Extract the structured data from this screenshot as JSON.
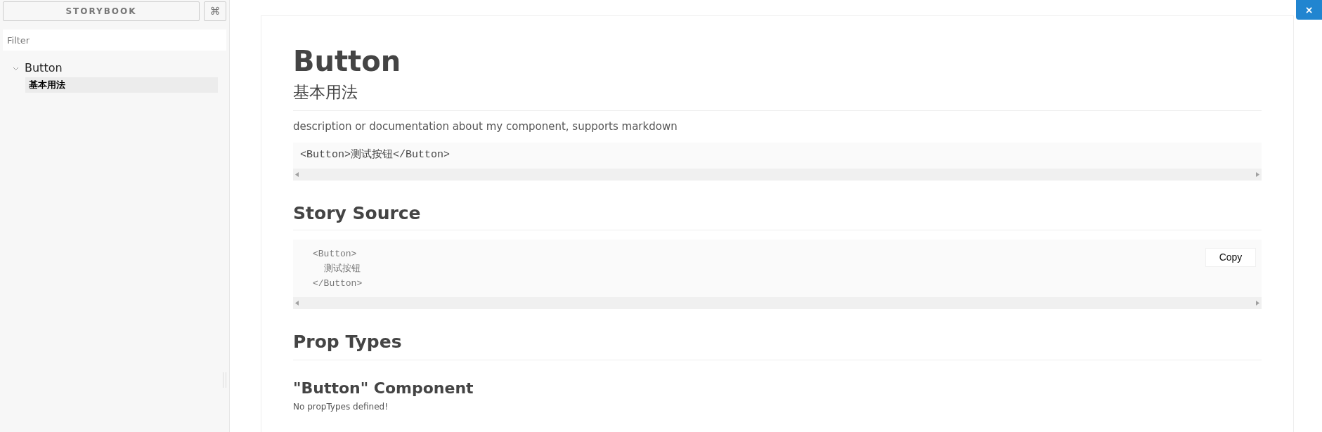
{
  "sidebar": {
    "brand": "STORYBOOK",
    "shortcut_button": "⌘",
    "filter": {
      "placeholder": "Filter"
    },
    "tree": [
      {
        "label": "Button",
        "expanded": true,
        "children": [
          {
            "label": "基本用法",
            "selected": true
          }
        ]
      }
    ]
  },
  "close_button": "×",
  "content": {
    "title": "Button",
    "subtitle": "基本用法",
    "description": "description or documentation about my component, supports markdown",
    "example_code": "<Button>测试按钮</Button>",
    "story_source": {
      "heading": "Story Source",
      "lines": [
        "<Button>",
        "  测试按钮",
        "</Button>"
      ],
      "copy_button": "Copy"
    },
    "prop_types": {
      "heading": "Prop Types",
      "component_heading": "\"Button\" Component",
      "note": "No propTypes defined!"
    }
  }
}
